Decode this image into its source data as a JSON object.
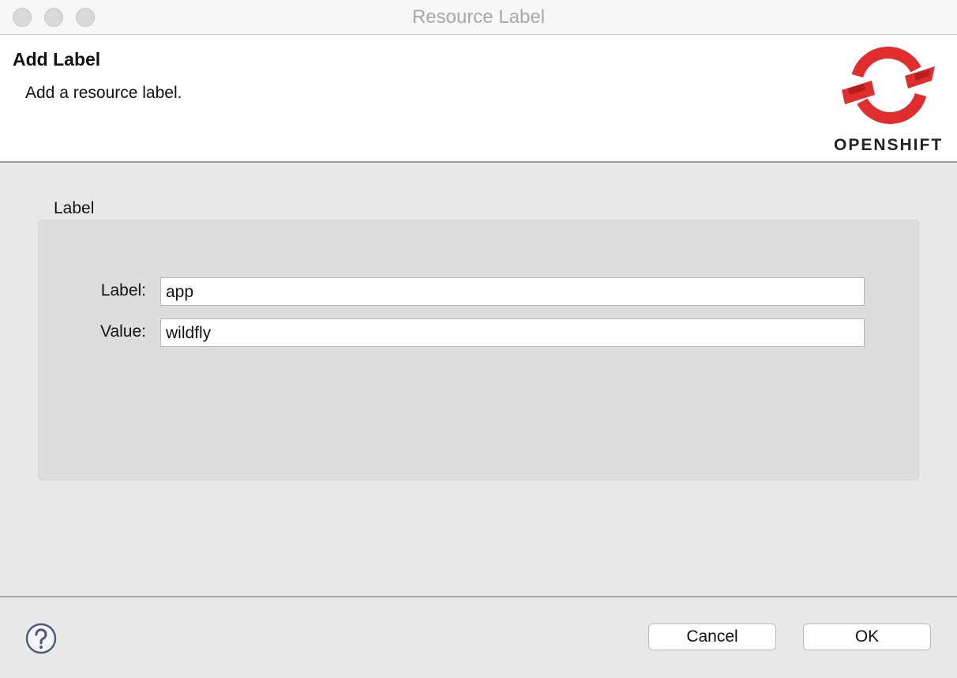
{
  "window": {
    "title": "Resource Label"
  },
  "banner": {
    "title": "Add Label",
    "description": "Add a resource label.",
    "logo_text": "OPENSHIFT",
    "logo_color": "#e02d2d"
  },
  "group": {
    "title": "Label",
    "fields": [
      {
        "label": "Label:",
        "value": "app"
      },
      {
        "label": "Value:",
        "value": "wildfly"
      }
    ]
  },
  "footer": {
    "help_icon": "question-mark-circle-icon",
    "cancel_label": "Cancel",
    "ok_label": "OK"
  }
}
